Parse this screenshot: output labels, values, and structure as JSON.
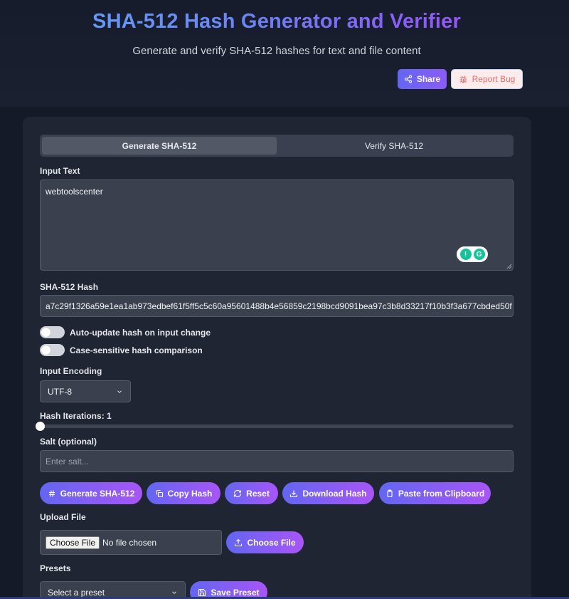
{
  "header": {
    "title": "SHA-512 Hash Generator and Verifier",
    "subtitle": "Generate and verify SHA-512 hashes for text and file content",
    "share_label": "Share",
    "report_bug_label": "Report Bug"
  },
  "tabs": [
    {
      "label": "Generate SHA-512",
      "active": true
    },
    {
      "label": "Verify SHA-512",
      "active": false
    }
  ],
  "input": {
    "label": "Input Text",
    "value": "webtoolscenter"
  },
  "hash": {
    "label": "SHA-512 Hash",
    "value": "a7c29f1326a59e1ea1ab973edbef61f5ff5c5c60a95601488b4e56859c2198bcd9091bea97c3b8d33217f10b3f3a677cbded50f"
  },
  "toggles": [
    {
      "label": "Auto-update hash on input change",
      "on": false
    },
    {
      "label": "Case-sensitive hash comparison",
      "on": false
    }
  ],
  "encoding": {
    "label": "Input Encoding",
    "selected": "UTF-8"
  },
  "iterations": {
    "label": "Hash Iterations: 1",
    "value": 1
  },
  "salt": {
    "label": "Salt (optional)",
    "placeholder": "Enter salt..."
  },
  "actions": {
    "generate": "Generate SHA-512",
    "copy": "Copy Hash",
    "reset": "Reset",
    "download": "Download Hash",
    "paste": "Paste from Clipboard"
  },
  "upload": {
    "label": "Upload File",
    "choose_native": "Choose File",
    "no_file": "No file chosen",
    "choose_button": "Choose File"
  },
  "presets": {
    "label": "Presets",
    "selected": "Select a preset",
    "save_label": "Save Preset"
  },
  "colors": {
    "accent_start": "#6366f1",
    "accent_end": "#a855f7",
    "background": "#141a27",
    "card": "#1f2533"
  }
}
